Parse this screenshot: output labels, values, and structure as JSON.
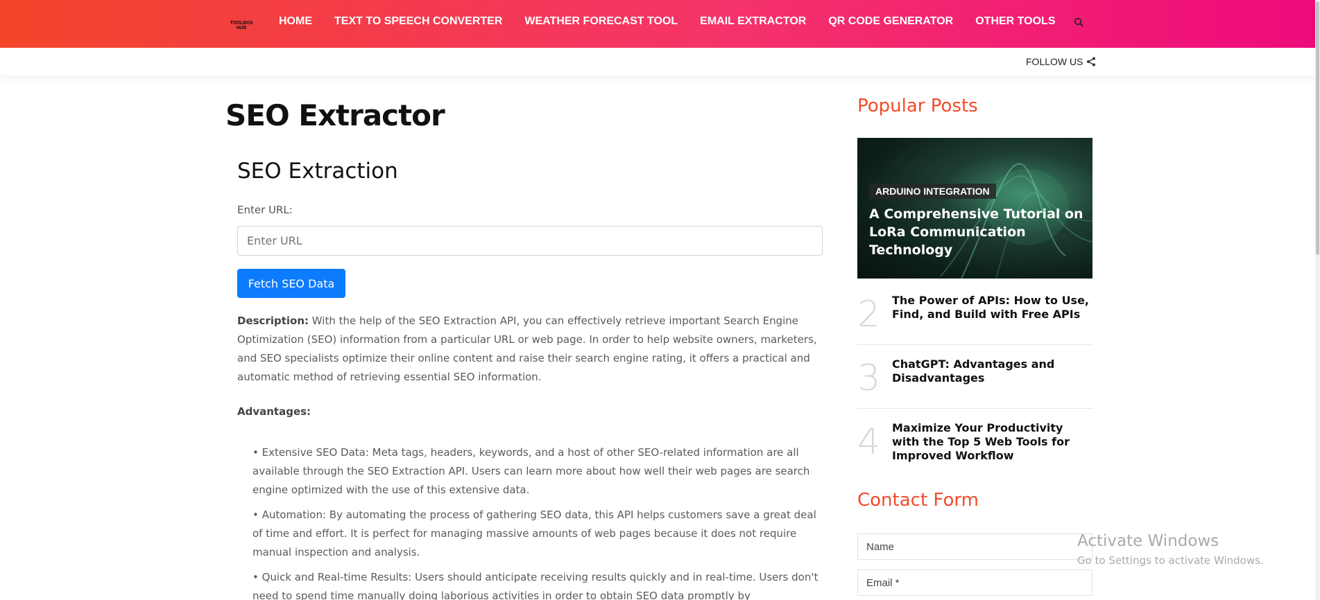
{
  "header": {
    "logo_line1": "TOOLBOX",
    "logo_line2": "HUB",
    "nav": [
      "HOME",
      "TEXT TO SPEECH CONVERTER",
      "WEATHER FORECAST TOOL",
      "EMAIL EXTRACTOR",
      "QR CODE GENERATOR",
      "OTHER TOOLS"
    ],
    "search_icon": "search-icon",
    "gradient_colors": [
      "#f4452a",
      "#ee0a7c"
    ]
  },
  "subbar": {
    "follow_label": "FOLLOW US",
    "share_icon": "share-icon"
  },
  "main": {
    "page_title": "SEO Extractor",
    "section_title": "SEO Extraction",
    "url_label": "Enter URL:",
    "url_placeholder": "Enter URL",
    "url_value": "",
    "fetch_button": "Fetch SEO Data",
    "description_label": "Description:",
    "description_text": " With the help of the SEO Extraction API, you can effectively retrieve important Search Engine Optimization (SEO) information from a particular URL or web page. In order to help website owners, marketers, and SEO specialists optimize their online content and raise their search engine rating, it offers a practical and automatic method of retrieving essential SEO information.",
    "advantages_heading": "Advantages:",
    "advantages": [
      "• Extensive SEO Data: Meta tags, headers, keywords, and a host of other SEO-related information are all available through the SEO Extraction API. Users can learn more about how well their web pages are search engine optimized with the use of this extensive data.",
      "• Automation: By automating the process of gathering SEO data, this API helps customers save a great deal of time and effort. It is perfect for managing massive amounts of web pages because it does not require manual inspection and analysis.",
      "• Quick and Real-time Results: Users should anticipate receiving results quickly and in real-time. Users don't need to spend time manually doing laborious activities in order to obtain SEO data promptly by"
    ],
    "button_color": "#0d7bfd"
  },
  "sidebar": {
    "popular_title": "Popular Posts",
    "featured": {
      "tag": "ARDUINO INTEGRATION",
      "title": "A Comprehensive Tutorial on LoRa Communication Technology"
    },
    "posts": [
      {
        "num": "2",
        "title": "The Power of APIs: How to Use, Find, and Build with Free APIs"
      },
      {
        "num": "3",
        "title": "ChatGPT: Advantages and Disadvantages"
      },
      {
        "num": "4",
        "title": "Maximize Your Productivity with the Top 5 Web Tools for Improved Workflow"
      }
    ],
    "contact_title": "Contact Form",
    "name_placeholder": "Name",
    "email_placeholder": "Email *",
    "accent_color": "#f24a2b"
  },
  "watermark": {
    "line1": "Activate Windows",
    "line2": "Go to Settings to activate Windows."
  }
}
